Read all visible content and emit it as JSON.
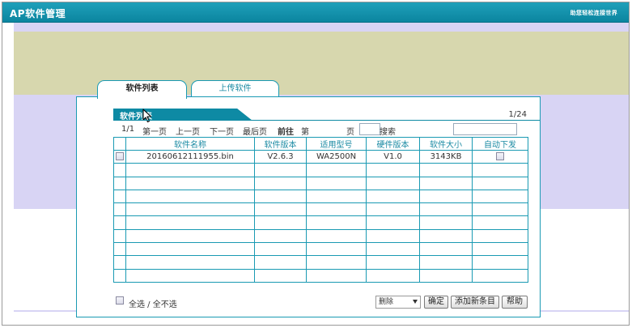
{
  "app": {
    "title": "AP软件管理",
    "slogan": "助您轻松连接世界"
  },
  "tabs": [
    {
      "label": "软件列表",
      "active": true
    },
    {
      "label": "上传软件",
      "active": false
    }
  ],
  "section": {
    "title": "软件列表",
    "page_count": "1/24"
  },
  "pager": {
    "current": "1/1",
    "first": "第一页",
    "prev": "上一页",
    "next": "下一页",
    "last": "最后页",
    "goto": "前往",
    "page_prefix": "第",
    "page_suffix": "页",
    "page_value": "",
    "search_label": "搜索",
    "search_value": ""
  },
  "table": {
    "columns": [
      "",
      "软件名称",
      "软件版本",
      "适用型号",
      "硬件版本",
      "软件大小",
      "自动下发"
    ],
    "rows": [
      {
        "name": "20160612111955.bin",
        "sw_version": "V2.6.3",
        "model": "WA2500N",
        "hw_version": "V1.0",
        "size": "3143KB"
      }
    ],
    "empty_rows": 9
  },
  "footer": {
    "select_all_label": "全选 / 全不选",
    "action_select": "删除",
    "ok_button": "确定",
    "add_button": "添加新条目",
    "help_button": "帮助"
  },
  "colors": {
    "accent": "#0e8aa4",
    "titlebar": "#1599b2",
    "lavender": "#d8d4f4",
    "olive": "#d7d7ae"
  },
  "icons": [
    "mouse-cursor-icon",
    "checkbox-icon",
    "dropdown-arrow-icon"
  ]
}
